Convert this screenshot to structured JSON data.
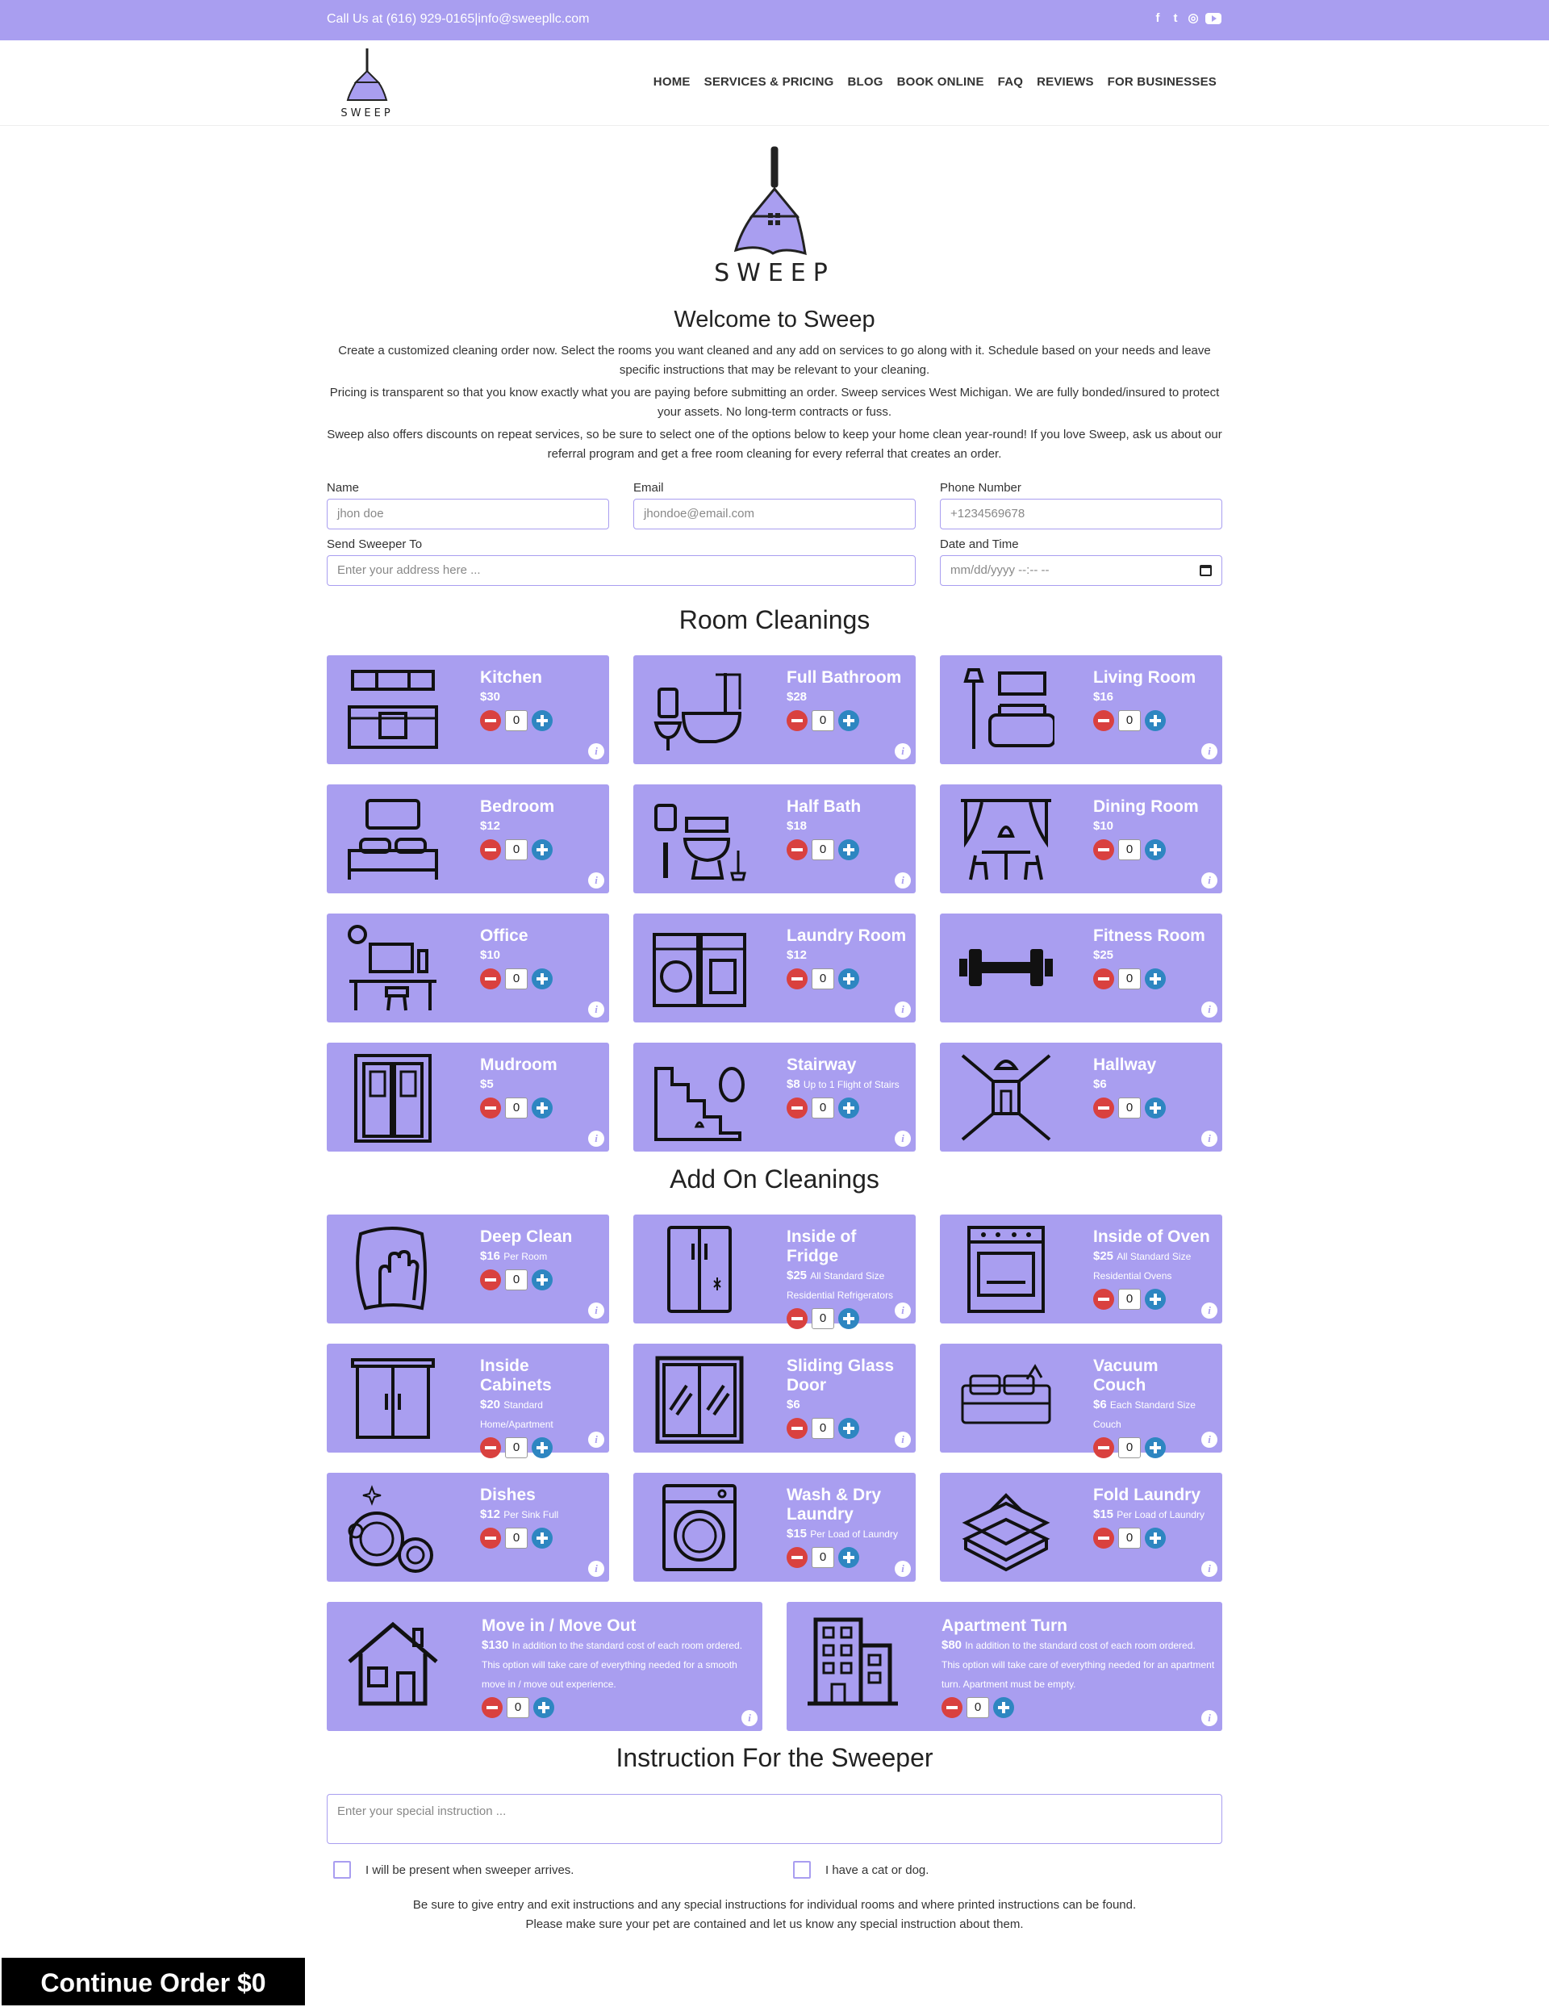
{
  "topbar": {
    "contact": "Call Us at (616) 929-0165|info@sweepllc.com"
  },
  "brand": {
    "name": "SWEEP",
    "color": "#a99ef0"
  },
  "nav": {
    "items": [
      "HOME",
      "SERVICES & PRICING",
      "BLOG",
      "BOOK ONLINE",
      "FAQ",
      "REVIEWS",
      "FOR BUSINESSES"
    ]
  },
  "welcome": {
    "title": "Welcome to Sweep",
    "p1": "Create a customized cleaning order now. Select the rooms you want cleaned and any add on services to go along with it. Schedule based on your needs and leave specific instructions that may be relevant to your cleaning.",
    "p2": "Pricing is transparent so that you know exactly what you are paying before submitting an order. Sweep services West Michigan. We are fully bonded/insured to protect your assets. No long-term contracts or fuss.",
    "p3": "Sweep also offers discounts on repeat services, so be sure to select one of the options below to keep your home clean year-round! If you love Sweep, ask us about our referral program and get a free room cleaning for every referral that creates an order."
  },
  "form": {
    "name_label": "Name",
    "name_placeholder": "jhon doe",
    "email_label": "Email",
    "email_placeholder": "jhondoe@email.com",
    "phone_label": "Phone Number",
    "phone_placeholder": "+1234569678",
    "address_label": "Send Sweeper To",
    "address_placeholder": "Enter your address here ...",
    "datetime_label": "Date and Time",
    "datetime_placeholder": "mm/dd/yyyy --:-- --"
  },
  "rooms": {
    "title": "Room Cleanings",
    "items": [
      {
        "name": "Kitchen",
        "price": "$30",
        "note": "",
        "qty": "0",
        "icon": "kitchen-icon"
      },
      {
        "name": "Full Bathroom",
        "price": "$28",
        "note": "",
        "qty": "0",
        "icon": "bathtub-icon"
      },
      {
        "name": "Living Room",
        "price": "$16",
        "note": "",
        "qty": "0",
        "icon": "sofa-icon"
      },
      {
        "name": "Bedroom",
        "price": "$12",
        "note": "",
        "qty": "0",
        "icon": "bed-icon"
      },
      {
        "name": "Half Bath",
        "price": "$18",
        "note": "",
        "qty": "0",
        "icon": "toilet-icon"
      },
      {
        "name": "Dining Room",
        "price": "$10",
        "note": "",
        "qty": "0",
        "icon": "dining-table-icon"
      },
      {
        "name": "Office",
        "price": "$10",
        "note": "",
        "qty": "0",
        "icon": "desk-icon"
      },
      {
        "name": "Laundry Room",
        "price": "$12",
        "note": "",
        "qty": "0",
        "icon": "washer-dryer-icon"
      },
      {
        "name": "Fitness Room",
        "price": "$25",
        "note": "",
        "qty": "0",
        "icon": "dumbbell-icon"
      },
      {
        "name": "Mudroom",
        "price": "$5",
        "note": "",
        "qty": "0",
        "icon": "double-door-icon"
      },
      {
        "name": "Stairway",
        "price": "$8",
        "note": "Up to 1 Flight of Stairs",
        "qty": "0",
        "icon": "stairs-icon"
      },
      {
        "name": "Hallway",
        "price": "$6",
        "note": "",
        "qty": "0",
        "icon": "hallway-icon"
      }
    ]
  },
  "addons": {
    "title": "Add On Cleanings",
    "items": [
      {
        "name": "Deep Clean",
        "price": "$16",
        "note": "Per Room",
        "qty": "0",
        "icon": "cleaning-cloth-icon"
      },
      {
        "name": "Inside of Fridge",
        "price": "$25",
        "note": "All Standard Size Residential Refrigerators",
        "qty": "0",
        "icon": "fridge-icon"
      },
      {
        "name": "Inside of Oven",
        "price": "$25",
        "note": "All Standard Size Residential Ovens",
        "qty": "0",
        "icon": "oven-icon"
      },
      {
        "name": "Inside Cabinets",
        "price": "$20",
        "note": "Standard Home/Apartment",
        "qty": "0",
        "icon": "cabinet-icon"
      },
      {
        "name": "Sliding Glass Door",
        "price": "$6",
        "note": "",
        "qty": "0",
        "icon": "sliding-door-icon"
      },
      {
        "name": "Vacuum Couch",
        "price": "$6",
        "note": "Each Standard Size Couch",
        "qty": "0",
        "icon": "couch-icon"
      },
      {
        "name": "Dishes",
        "price": "$12",
        "note": "Per Sink Full",
        "qty": "0",
        "icon": "dishes-icon"
      },
      {
        "name": "Wash & Dry Laundry",
        "price": "$15",
        "note": "Per Load of Laundry",
        "qty": "0",
        "icon": "washing-machine-icon"
      },
      {
        "name": "Fold Laundry",
        "price": "$15",
        "note": "Per Load of Laundry",
        "qty": "0",
        "icon": "folded-clothes-icon"
      }
    ],
    "wide": [
      {
        "name": "Move in / Move Out",
        "price": "$130",
        "note": "In addition to the standard cost of each room ordered. This option will take care of everything needed for a smooth move in / move out experience.",
        "qty": "0",
        "icon": "house-icon"
      },
      {
        "name": "Apartment Turn",
        "price": "$80",
        "note": "In addition to the standard cost of each room ordered. This option will take care of everything needed for an apartment turn. Apartment must be empty.",
        "qty": "0",
        "icon": "apartment-building-icon"
      }
    ]
  },
  "instructions": {
    "title": "Instruction For the Sweeper",
    "placeholder": "Enter your special instruction ...",
    "check_present": "I will be present when sweeper arrives.",
    "check_pet": "I have a cat or dog.",
    "note1": "Be sure to give entry and exit instructions and any special instructions for individual rooms and where printed instructions can be found.",
    "note2": "Please make sure your pet are contained and let us know any special instruction about them."
  },
  "cta": {
    "label": "Continue Order $0"
  }
}
